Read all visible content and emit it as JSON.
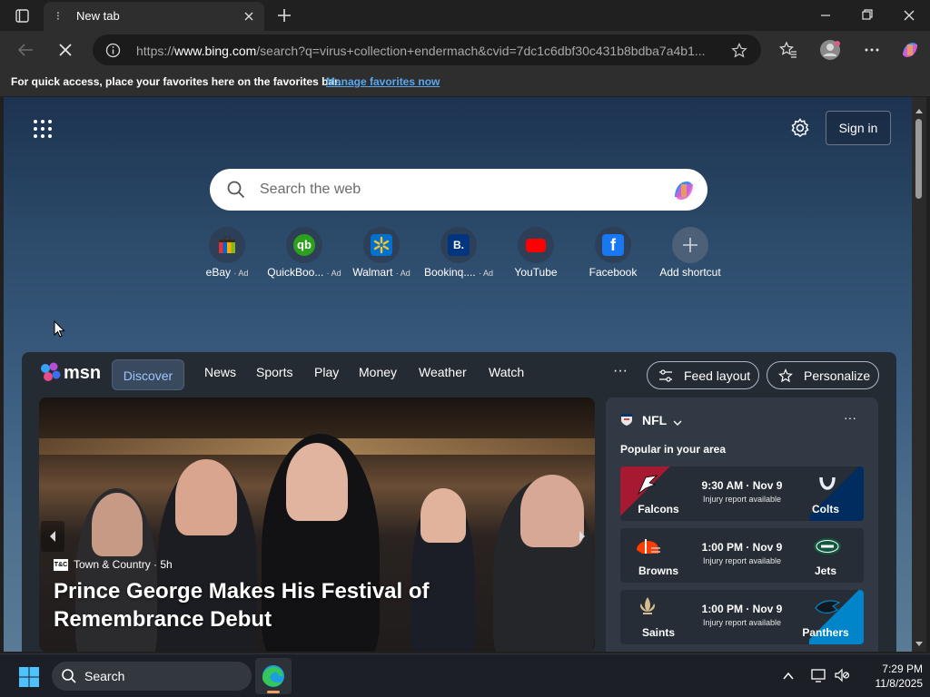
{
  "browser": {
    "tab_title": "New tab",
    "url_host": "www.bing.com",
    "url_scheme": "https://",
    "url_path": "/search?q=virus+collection+endermach&cvid=7dc1c6dbf30c431b8bdba7a4b1..."
  },
  "favorites_bar": {
    "message": "For quick access, place your favorites here on the favorites bar.",
    "link": "Manage favorites now"
  },
  "newtab": {
    "sign_in": "Sign in",
    "search_placeholder": "Search the web",
    "shortcuts": [
      {
        "label": "eBay",
        "ad": "· Ad",
        "icon": "ebay-icon"
      },
      {
        "label": "QuickBoo...",
        "ad": "· Ad",
        "icon": "quickbooks-icon"
      },
      {
        "label": "Walmart",
        "ad": "· Ad",
        "icon": "walmart-icon"
      },
      {
        "label": "Bookinq....",
        "ad": "· Ad",
        "icon": "booking-icon"
      },
      {
        "label": "YouTube",
        "ad": "",
        "icon": "youtube-icon"
      },
      {
        "label": "Facebook",
        "ad": "",
        "icon": "facebook-icon"
      },
      {
        "label": "Add shortcut",
        "ad": "",
        "icon": "plus-icon"
      }
    ]
  },
  "msn": {
    "logo": "msn",
    "tabs": [
      "Discover",
      "News",
      "Sports",
      "Play",
      "Money",
      "Weather",
      "Watch"
    ],
    "more": "···",
    "feed_layout": "Feed layout",
    "personalize": "Personalize",
    "hero": {
      "source_badge": "T&C",
      "source": "Town & Country · 5h",
      "headline": "Prince George Makes His Festival of Remembrance Debut"
    },
    "nfl": {
      "title": "NFL",
      "more": "···",
      "subtitle": "Popular in your area",
      "games": [
        {
          "home": "Falcons",
          "away": "Colts",
          "time": "9:30 AM · Nov 9",
          "note": "Injury report available",
          "home_color": "#a71930",
          "away_color": "#002c5f"
        },
        {
          "home": "Browns",
          "away": "Jets",
          "time": "1:00 PM · Nov 9",
          "note": "Injury report available",
          "home_color": "#3a2a22",
          "away_color": "#125740"
        },
        {
          "home": "Saints",
          "away": "Panthers",
          "time": "1:00 PM · Nov 9",
          "note": "Injury report available",
          "home_color": "#2f3540",
          "away_color": "#0085ca"
        }
      ]
    }
  },
  "taskbar": {
    "search_label": "Search",
    "time": "7:29 PM",
    "date": "11/8/2025"
  }
}
